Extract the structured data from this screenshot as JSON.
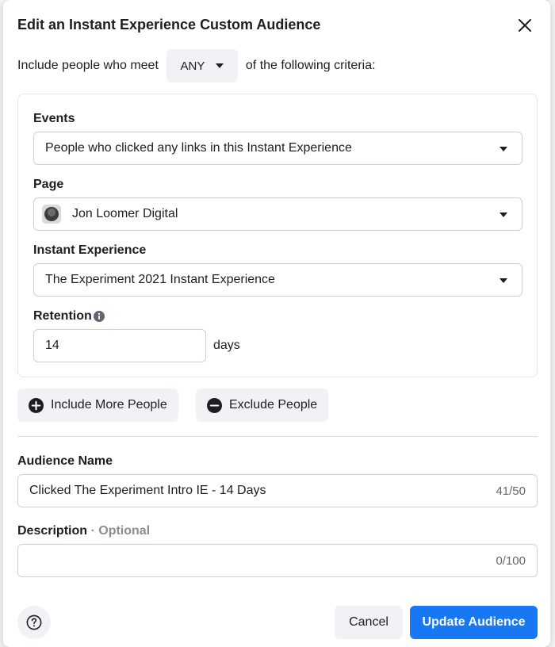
{
  "modal": {
    "title": "Edit an Instant Experience Custom Audience",
    "close_icon": "close-icon"
  },
  "criteria": {
    "prefix": "Include people who meet",
    "match_value": "ANY",
    "suffix": "of the following criteria:"
  },
  "events": {
    "label": "Events",
    "value": "People who clicked any links in this Instant Experience"
  },
  "page": {
    "label": "Page",
    "value": "Jon Loomer Digital"
  },
  "instant_experience": {
    "label": "Instant Experience",
    "value": "The Experiment 2021 Instant Experience"
  },
  "retention": {
    "label": "Retention",
    "info_icon": "info-icon",
    "value": "14",
    "unit": "days"
  },
  "actions": {
    "include_more": "Include More People",
    "exclude": "Exclude People"
  },
  "audience_name": {
    "label": "Audience Name",
    "value": "Clicked The Experiment Intro IE - 14 Days",
    "counter": "41/50"
  },
  "description": {
    "label": "Description",
    "optional": "· Optional",
    "value": "",
    "counter": "0/100"
  },
  "footer": {
    "help_icon": "help-icon",
    "cancel": "Cancel",
    "update": "Update Audience"
  },
  "colors": {
    "primary": "#1877f2",
    "button_gray": "#f0f2f5",
    "border": "#ccd0d5"
  }
}
